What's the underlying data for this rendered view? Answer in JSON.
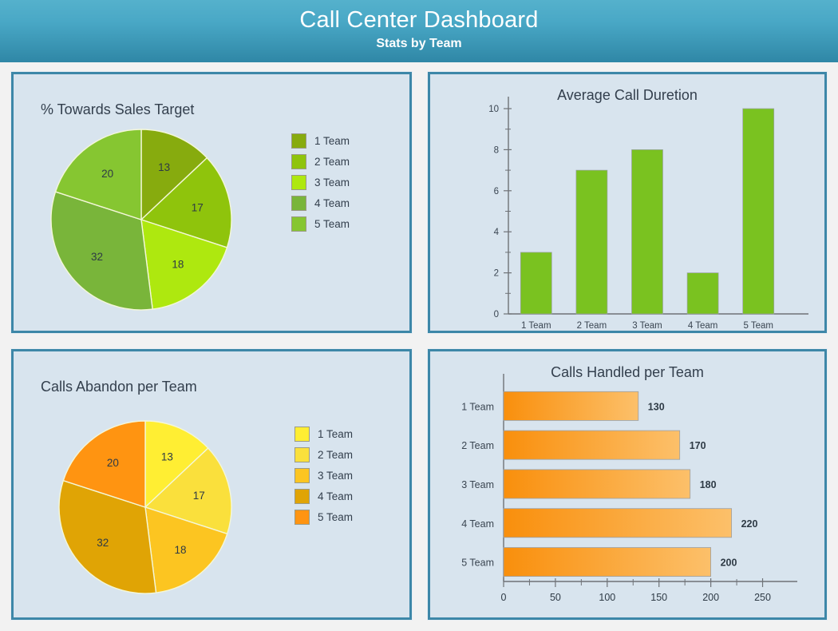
{
  "header": {
    "title": "Call Center Dashboard",
    "subtitle": "Stats by Team"
  },
  "theme": {
    "page_bg": "#f2f2f2",
    "panel_bg": "#d8e4ee",
    "panel_border": "#3d87a8",
    "header_gradient_top": "#55b1cc",
    "header_gradient_bottom": "#2f87a6",
    "title_text": "#333f4d"
  },
  "panels": {
    "sales": {
      "title": "% Towards Sales Target"
    },
    "duration": {
      "title": "Average Call Duretion"
    },
    "abandon": {
      "title": "Calls Abandon per Team"
    },
    "handled": {
      "title": "Calls Handled per Team"
    }
  },
  "chart_data": [
    {
      "id": "sales-pie",
      "type": "pie",
      "title": "% Towards Sales Target",
      "categories": [
        "1 Team",
        "2 Team",
        "3 Team",
        "4 Team",
        "5 Team"
      ],
      "values": [
        13,
        17,
        18,
        32,
        20
      ],
      "labels": [
        "13",
        "17",
        "18",
        "32",
        "20"
      ],
      "colors": [
        "#87ab0e",
        "#8fc40c",
        "#aee80f",
        "#79b53a",
        "#86c631"
      ],
      "legend_position": "right",
      "start_angle": 0,
      "direction": "clockwise"
    },
    {
      "id": "duration-bar",
      "type": "bar",
      "title": "Average Call Duretion",
      "categories": [
        "1 Team",
        "2 Team",
        "3 Team",
        "4 Team",
        "5 Team"
      ],
      "values": [
        3,
        7,
        8,
        2,
        10
      ],
      "xlabel": "",
      "ylabel": "",
      "ylim": [
        0,
        10
      ],
      "yticks": [
        0,
        2,
        4,
        6,
        8,
        10
      ],
      "yticklabels": [
        "0",
        "2",
        "4",
        "6",
        "8",
        "10"
      ],
      "minor_yticks": [
        1,
        3,
        5,
        7,
        9
      ],
      "grid": false,
      "bar_color": "#7ac220",
      "legend_position": "none"
    },
    {
      "id": "abandon-pie",
      "type": "pie",
      "title": "Calls Abandon per Team",
      "categories": [
        "1 Team",
        "2 Team",
        "3 Team",
        "4 Team",
        "5 Team"
      ],
      "values": [
        13,
        17,
        18,
        32,
        20
      ],
      "labels": [
        "13",
        "17",
        "18",
        "32",
        "20"
      ],
      "colors": [
        "#ffee33",
        "#fae03c",
        "#fcc521",
        "#e0a405",
        "#ff9411"
      ],
      "legend_position": "right",
      "start_angle": 0,
      "direction": "clockwise"
    },
    {
      "id": "handled-hbar",
      "type": "bar",
      "orientation": "horizontal",
      "title": "Calls Handled per Team",
      "categories": [
        "1 Team",
        "2 Team",
        "3 Team",
        "4 Team",
        "5 Team"
      ],
      "values": [
        130,
        170,
        180,
        220,
        200
      ],
      "value_labels": [
        "130",
        "170",
        "180",
        "220",
        "200"
      ],
      "xlabel": "",
      "ylabel": "",
      "xlim": [
        0,
        265
      ],
      "xticks": [
        0,
        50,
        100,
        150,
        200,
        250
      ],
      "xticklabels": [
        "0",
        "50",
        "100",
        "150",
        "200",
        "250"
      ],
      "minor_xticks": [
        25,
        75,
        125,
        175,
        225
      ],
      "grid": false,
      "bar_gradient_start": "#f98f0c",
      "bar_gradient_end": "#fcc06a",
      "legend_position": "none"
    }
  ]
}
